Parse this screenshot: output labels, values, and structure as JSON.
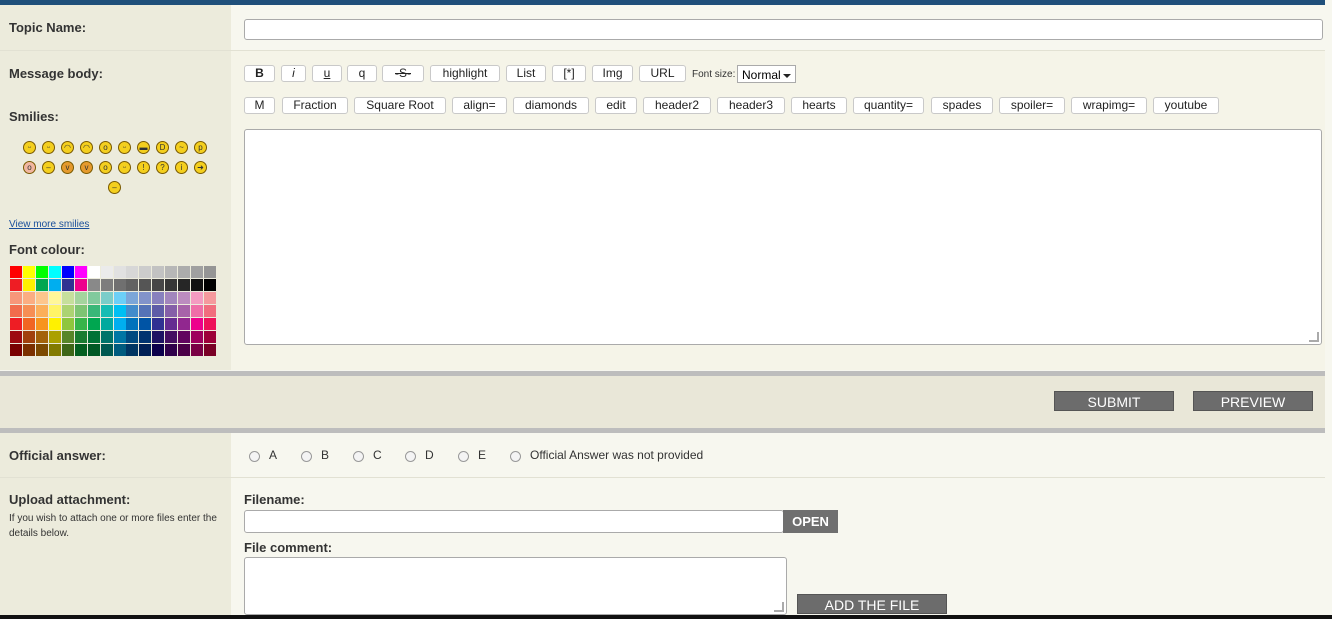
{
  "form": {
    "topic_label": "Topic Name:",
    "topic_value": "",
    "message_label": "Message body:",
    "smilies_label": "Smilies:",
    "view_more_smilies": "View more smilies",
    "font_colour_label": "Font colour:",
    "font_size_label": "Font size:",
    "font_size_value": "Normal",
    "message_value": ""
  },
  "toolbar_row1": [
    "B",
    "i",
    "u",
    "q",
    "-S-",
    "highlight",
    "List",
    "[*]",
    "Img",
    "URL"
  ],
  "toolbar_row2": [
    "M",
    "Fraction",
    "Square Root",
    "align=",
    "diamonds",
    "edit",
    "header2",
    "header3",
    "hearts",
    "quantity=",
    "spades",
    "spoiler=",
    "wrapimg=",
    "youtube"
  ],
  "actions": {
    "submit": "SUBMIT",
    "preview": "PREVIEW"
  },
  "official_answer": {
    "label": "Official answer:",
    "options": [
      "A",
      "B",
      "C",
      "D",
      "E",
      "Official Answer was not provided"
    ]
  },
  "upload": {
    "label": "Upload attachment:",
    "help": "If you wish to attach one or more files enter the details below.",
    "filename_label": "Filename:",
    "open_button": "OPEN",
    "file_comment_label": "File comment:",
    "add_file_button": "ADD THE FILE"
  },
  "colors": {
    "header_bar": "#1f4f7a",
    "left_panel": "#ecebdc",
    "dark_button": "#6c6c6c",
    "link": "#1a4f9b"
  }
}
